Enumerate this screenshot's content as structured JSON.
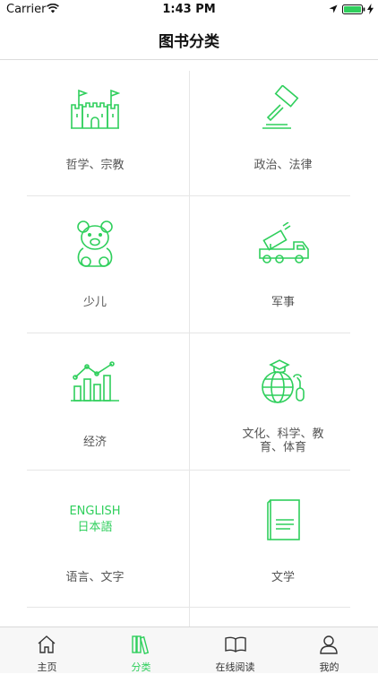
{
  "status_bar": {
    "carrier": "Carrier",
    "time": "1:43 PM"
  },
  "nav": {
    "title": "图书分类"
  },
  "categories": [
    {
      "label": "哲学、宗教",
      "icon": "castle-icon"
    },
    {
      "label": "政治、法律",
      "icon": "gavel-icon"
    },
    {
      "label": "少儿",
      "icon": "teddy-bear-icon"
    },
    {
      "label": "军事",
      "icon": "missile-truck-icon"
    },
    {
      "label": "经济",
      "icon": "bar-chart-icon"
    },
    {
      "label_line1": "文化、科学、教",
      "label_line2": "育、体育",
      "icon": "globe-mouse-icon"
    },
    {
      "label": "语言、文字",
      "icon_text_line1": "ENGLISH",
      "icon_text_line2": "日本語"
    },
    {
      "label": "文学",
      "icon": "book-icon"
    }
  ],
  "tabs": [
    {
      "label": "主页",
      "icon": "home-icon"
    },
    {
      "label": "分类",
      "icon": "books-icon"
    },
    {
      "label": "在线阅读",
      "icon": "open-book-icon"
    },
    {
      "label": "我的",
      "icon": "person-icon"
    }
  ],
  "colors": {
    "accent": "#2fcf5c",
    "divider": "#e6e6e6"
  }
}
